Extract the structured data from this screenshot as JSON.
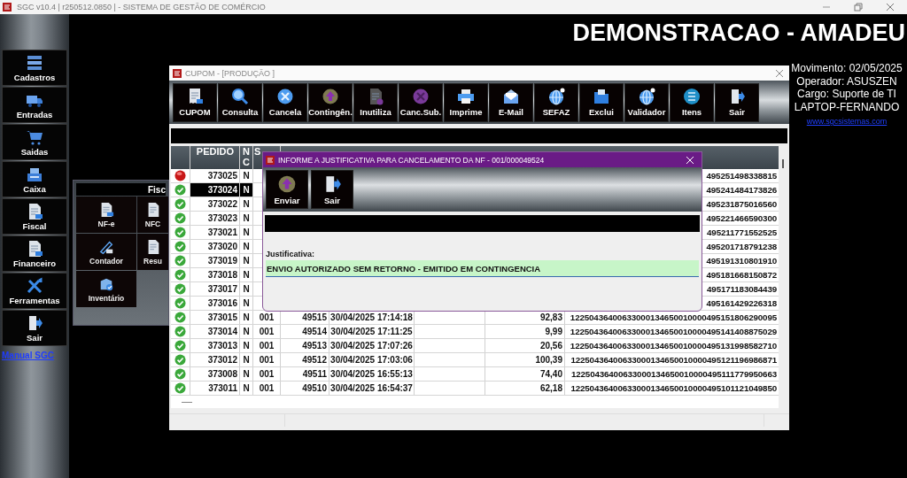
{
  "app_title": "SGC v10.4 | r250512.0850 | - SISTEMA DE GESTÃO DE COMÉRCIO",
  "sidebar": {
    "items": [
      {
        "label": "Cadastros"
      },
      {
        "label": "Entradas"
      },
      {
        "label": "Saidas"
      },
      {
        "label": "Caixa"
      },
      {
        "label": "Fiscal"
      },
      {
        "label": "Financeiro"
      },
      {
        "label": "Ferramentas"
      },
      {
        "label": "Sair"
      }
    ],
    "manual_link": "Manual SGC"
  },
  "company_title": "DEMONSTRACAO - AMADEU",
  "session_info": {
    "lines": [
      "Movimento: 02/05/2025",
      "Operador: ASUSZEN",
      "Cargo: Suporte de TI",
      "LAPTOP-FERNANDO"
    ],
    "website": "www.sgcsistemas.com"
  },
  "fiscal_panel": {
    "title": "Fisc",
    "buttons": [
      {
        "label": "NF-e"
      },
      {
        "label": "NFC"
      },
      {
        "label": "Contador"
      },
      {
        "label": "Resu"
      },
      {
        "label": "Inventário"
      }
    ]
  },
  "cupom_window": {
    "title": "CUPOM - [PRODUÇÃO  ]",
    "toolbar": [
      "CUPOM",
      "Consulta",
      "Cancela",
      "Contingên.",
      "Inutiliza",
      "Canc.Sub.",
      "Imprime",
      "E-Mail",
      "SEFAZ",
      "Exclui",
      "Validador",
      "Itens",
      "Sair"
    ],
    "table": {
      "columns": [
        "PEDIDO",
        "N C",
        "S"
      ],
      "rows": [
        {
          "kind": "error",
          "selected": false,
          "pedido": "373025",
          "nc": "N",
          "chave": "495251498338815"
        },
        {
          "kind": "ok",
          "selected": true,
          "pedido": "373024",
          "nc": "N",
          "chave": "495241484173826"
        },
        {
          "kind": "ok",
          "selected": false,
          "pedido": "373022",
          "nc": "N",
          "chave": "495231875016560"
        },
        {
          "kind": "ok",
          "selected": false,
          "pedido": "373023",
          "nc": "N",
          "chave": "495221466590300"
        },
        {
          "kind": "ok",
          "selected": false,
          "pedido": "373021",
          "nc": "N",
          "chave": "495211771552525"
        },
        {
          "kind": "ok",
          "selected": false,
          "pedido": "373020",
          "nc": "N",
          "chave": "495201718791238"
        },
        {
          "kind": "ok",
          "selected": false,
          "pedido": "373019",
          "nc": "N",
          "chave": "495191310801910"
        },
        {
          "kind": "ok",
          "selected": false,
          "pedido": "373018",
          "nc": "N",
          "chave": "495181668150872"
        },
        {
          "kind": "ok",
          "selected": false,
          "pedido": "373017",
          "nc": "N",
          "chave": "495171183084439"
        },
        {
          "kind": "ok",
          "selected": false,
          "pedido": "373016",
          "nc": "N",
          "chave": "495161429226318"
        },
        {
          "kind": "ok",
          "selected": false,
          "pedido": "373015",
          "nc": "N",
          "serie": "001",
          "numero": "49515",
          "data_hora": "30/04/2025 17:14:18",
          "valor": "92,83",
          "chave": "12250436400633000134650010000495151806290095"
        },
        {
          "kind": "ok",
          "selected": false,
          "pedido": "373014",
          "nc": "N",
          "serie": "001",
          "numero": "49514",
          "data_hora": "30/04/2025 17:11:25",
          "valor": "9,99",
          "chave": "12250436400633000134650010000495141408875029"
        },
        {
          "kind": "ok",
          "selected": false,
          "pedido": "373013",
          "nc": "N",
          "serie": "001",
          "numero": "49513",
          "data_hora": "30/04/2025 17:07:26",
          "valor": "20,56",
          "chave": "12250436400633000134650010000495131998582710"
        },
        {
          "kind": "ok",
          "selected": false,
          "pedido": "373012",
          "nc": "N",
          "serie": "001",
          "numero": "49512",
          "data_hora": "30/04/2025 17:03:06",
          "valor": "100,39",
          "chave": "12250436400633000134650010000495121196986871"
        },
        {
          "kind": "ok",
          "selected": false,
          "pedido": "373008",
          "nc": "N",
          "serie": "001",
          "numero": "49511",
          "data_hora": "30/04/2025 16:55:13",
          "valor": "74,40",
          "chave": "12250436400633000134650010000495111779950663"
        },
        {
          "kind": "ok",
          "selected": false,
          "pedido": "373011",
          "nc": "N",
          "serie": "001",
          "numero": "49510",
          "data_hora": "30/04/2025 16:54:37",
          "valor": "62,18",
          "chave": "12250436400633000134650010000495101121049850"
        }
      ]
    }
  },
  "dialog": {
    "title": "INFORME A JUSTIFICATIVA PARA CANCELAMENTO DA NF - 001/000049524",
    "toolbar": [
      "Enviar",
      "Sair"
    ],
    "label": "Justificativa:",
    "value": "ENVIO AUTORIZADO SEM RETORNO - EMITIDO EM CONTINGENCIA"
  }
}
